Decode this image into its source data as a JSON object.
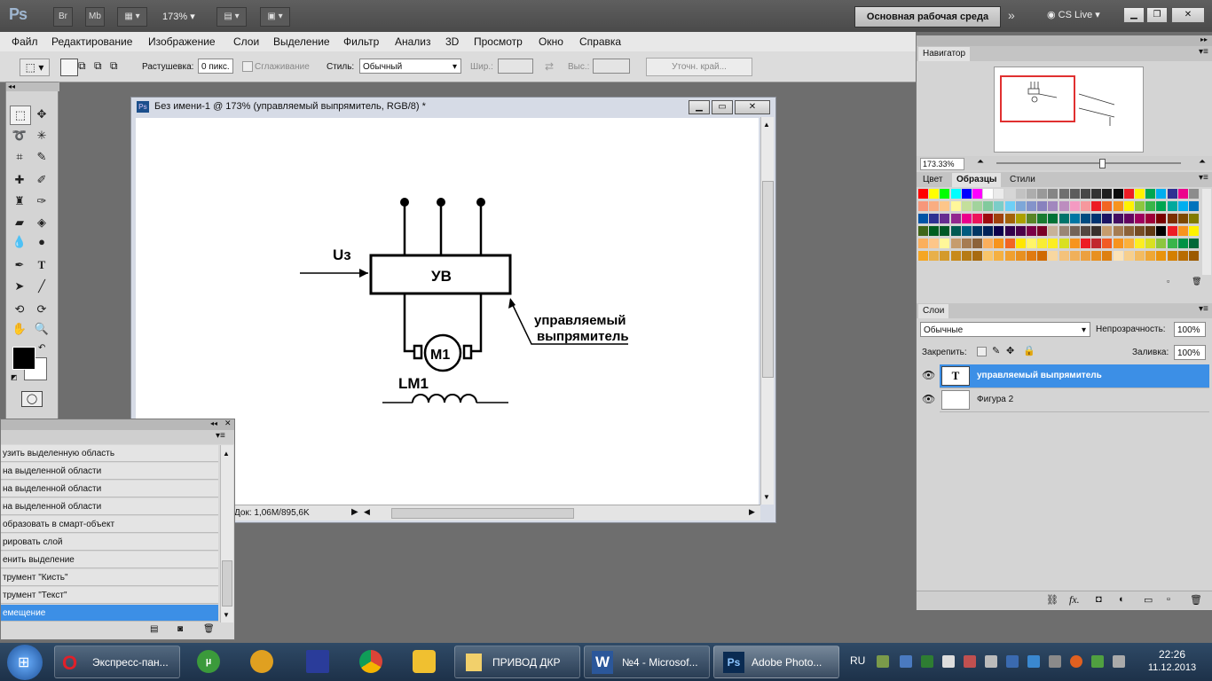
{
  "app": {
    "logo": "Ps",
    "bridge": "Br",
    "minibridge": "Mb",
    "zoom": "173%",
    "workspace": "Основная рабочая среда",
    "cs_live": "CS Live"
  },
  "menu": [
    "Файл",
    "Редактирование",
    "Изображение",
    "Слои",
    "Выделение",
    "Фильтр",
    "Анализ",
    "3D",
    "Просмотр",
    "Окно",
    "Справка"
  ],
  "options": {
    "feather_label": "Растушевка:",
    "feather_value": "0 пикс.",
    "antialias_label": "Сглаживание",
    "style_label": "Стиль:",
    "style_value": "Обычный",
    "width_label": "Шир.:",
    "height_label": "Выс.:",
    "refine_edge": "Уточн. край..."
  },
  "document": {
    "title": "Без имени-1 @ 173% (управляемый выпрямитель, RGB/8) *",
    "status": "Док: 1,06M/895,6K"
  },
  "drawing": {
    "u3": "Uз",
    "uv": "УВ",
    "m1": "M1",
    "lm1": "LM1",
    "label_line1": "управляемый",
    "label_line2": "выпрямитель"
  },
  "history": {
    "items": [
      "узить выделенную область",
      "на выделенной области",
      "на выделенной области",
      "на выделенной области",
      "образовать в смарт-объект",
      "рировать слой",
      "енить выделение",
      "трумент \"Кисть\"",
      "трумент \"Текст\"",
      "емещение"
    ],
    "selected_index": 9
  },
  "navigator": {
    "tab": "Навигатор",
    "zoom": "173.33%"
  },
  "swatch_tabs": [
    "Цвет",
    "Образцы",
    "Стили"
  ],
  "layers": {
    "tab": "Слои",
    "blend": "Обычные",
    "opacity_label": "Непрозрачность:",
    "opacity": "100%",
    "lock_label": "Закрепить:",
    "fill_label": "Заливка:",
    "fill": "100%",
    "items": [
      {
        "name": "управляемый выпрямитель",
        "type": "text",
        "selected": true
      },
      {
        "name": "Фигура 2",
        "type": "shape",
        "selected": false
      }
    ]
  },
  "taskbar": {
    "tasks": [
      "Экспресс-пан...",
      "ПРИВОД ДКР",
      "№4 - Microsof...",
      "Adobe Photo..."
    ],
    "lang": "RU",
    "time": "22:26",
    "date": "11.12.2013"
  },
  "colors": {
    "accent": "#3c8fe6",
    "selection_red": "#e03030"
  }
}
